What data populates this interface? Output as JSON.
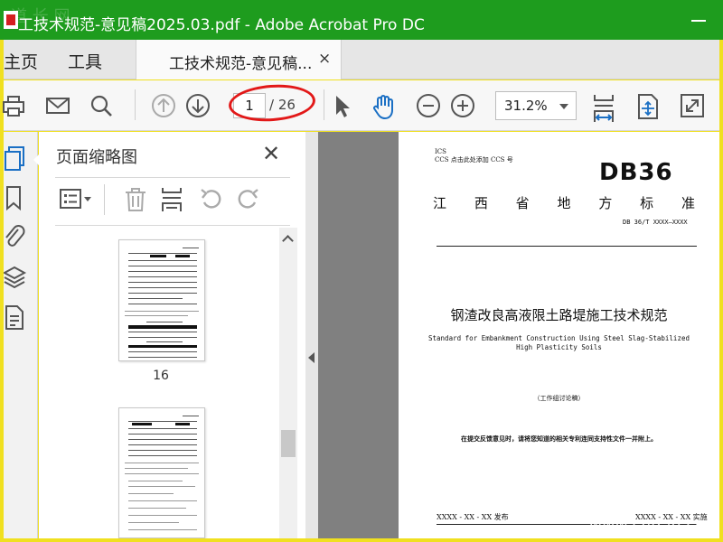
{
  "window": {
    "title": "工技术规范-意见稿2025.03.pdf - Adobe Acrobat Pro DC",
    "watermark_top": "道 长 网"
  },
  "menu": {
    "home": "主页",
    "tools": "工具"
  },
  "tab": {
    "label": "工技术规范-意见稿...",
    "close": "×"
  },
  "toolbar": {
    "current_page": "1",
    "total_pages": "/ 26",
    "zoom": "31.2%"
  },
  "thumbnail_panel": {
    "title": "页面缩略图",
    "close": "✕",
    "thumbs": [
      {
        "label": "16"
      },
      {
        "label": ""
      }
    ]
  },
  "document_page": {
    "ics": "ICS",
    "ccs": "CCS 点击此处添加 CCS 号",
    "db_mark": "DB36",
    "province_chars": [
      "江",
      "西",
      "省",
      "地",
      "方",
      "标",
      "准"
    ],
    "code": "DB 36/T XXXX—XXXX",
    "title_cn": "钢渣改良高液限土路堤施工技术规范",
    "title_en_line1": "Standard for Embankment Construction Using Steel Slag-Stabilized",
    "title_en_line2": "High Plasticity Soils",
    "draft_note": "（工作组讨论稿）",
    "notice": "在提交反馈意见时，请将您知道的相关专利连同支持性文件一并附上。",
    "issue_date": "XXXX - XX - XX 发布",
    "impl_date": "XXXX - XX - XX 实施"
  },
  "watermark_bottom": "www.cndao.com",
  "colors": {
    "titlebar": "#1e9c1e",
    "accent_blue": "#1a6fc4",
    "annotation_red": "#e21818",
    "frame_yellow": "#f0e020"
  }
}
